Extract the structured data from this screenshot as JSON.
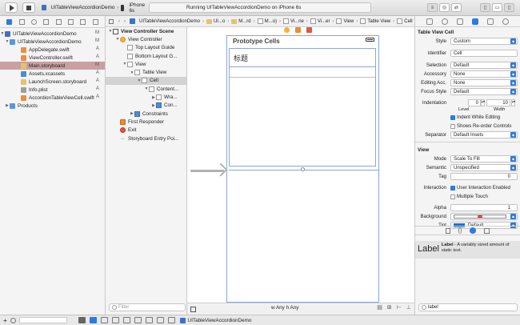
{
  "toolbar": {
    "scheme_target": "UITableViewAccordionDemo",
    "scheme_device": "iPhone 6s",
    "activity": "Running UITableViewAccordionDemo on iPhone 6s",
    "left_icons": [
      "run-icon",
      "stop-icon"
    ],
    "right_icons": [
      "editor-standard-icon",
      "editor-assistant-icon",
      "editor-version-icon",
      "navigator-toggle-icon",
      "debug-toggle-icon",
      "utilities-toggle-icon"
    ]
  },
  "navigator": {
    "project": {
      "name": "UITableViewAccordionDemo",
      "badge": "M"
    },
    "group": {
      "name": "UITableViewAccordionDemo",
      "badge": "M"
    },
    "files": [
      {
        "name": "AppDelegate.swift",
        "badge": "A",
        "kind": "swift"
      },
      {
        "name": "ViewController.swift",
        "badge": "A",
        "kind": "swift"
      },
      {
        "name": "Main.storyboard",
        "badge": "M",
        "kind": "storyboard"
      },
      {
        "name": "Assets.xcassets",
        "badge": "A",
        "kind": "assets"
      },
      {
        "name": "LaunchScreen.storyboard",
        "badge": "A",
        "kind": "storyboard"
      },
      {
        "name": "Info.plist",
        "badge": "A",
        "kind": "plist"
      },
      {
        "name": "AccordionTableViewCell.swift",
        "badge": "A",
        "kind": "swift"
      }
    ],
    "products": {
      "name": "Products"
    },
    "selected_file": "Main.storyboard"
  },
  "breadcrumbs": [
    "UITableViewAccordionDemo",
    "UI...o",
    "M...rd",
    "M...o)",
    "Vi...ne",
    "Vi...er",
    "View",
    "Table View",
    "Cell"
  ],
  "outline": {
    "scene": "View Controller Scene",
    "items": [
      {
        "label": "View Controller",
        "indent": 1,
        "icon": "vc"
      },
      {
        "label": "Top Layout Guide",
        "indent": 2,
        "icon": "box"
      },
      {
        "label": "Bottom Layout G...",
        "indent": 2,
        "icon": "box"
      },
      {
        "label": "View",
        "indent": 2,
        "icon": "box"
      },
      {
        "label": "Table View",
        "indent": 3,
        "icon": "box"
      },
      {
        "label": "Cell",
        "indent": 4,
        "icon": "box"
      },
      {
        "label": "Content...",
        "indent": 5,
        "icon": "box"
      },
      {
        "label": "Wra...",
        "indent": 6,
        "icon": "box"
      },
      {
        "label": "Con...",
        "indent": 6,
        "icon": "blue"
      },
      {
        "label": "Constraints",
        "indent": 3,
        "icon": "blue"
      },
      {
        "label": "First Responder",
        "indent": 1,
        "icon": "orange"
      },
      {
        "label": "Exit",
        "indent": 1,
        "icon": "red"
      },
      {
        "label": "Storyboard Entry Poi...",
        "indent": 1,
        "icon": "arrow"
      }
    ],
    "filter_placeholder": "Filter"
  },
  "canvas": {
    "prototype_label": "Prototype Cells",
    "cell_text": "标题",
    "size_class_w": "Any",
    "size_class_h": "Any",
    "size_class_prefix_w": "w",
    "size_class_prefix_h": "h"
  },
  "status_bar": {
    "target": "UITableViewAccordionDemo"
  },
  "inspector": {
    "section_cell": "Table View Cell",
    "style": {
      "label": "Style",
      "value": "Custom"
    },
    "identifier": {
      "label": "Identifier",
      "value": "Cell"
    },
    "selection": {
      "label": "Selection",
      "value": "Default"
    },
    "accessory": {
      "label": "Accessory",
      "value": "None"
    },
    "editing_acc": {
      "label": "Editing Acc.",
      "value": "None"
    },
    "focus_style": {
      "label": "Focus Style",
      "value": "Default"
    },
    "indentation": {
      "label": "Indentation",
      "level": "0",
      "width": "10",
      "level_label": "Level",
      "width_label": "Width"
    },
    "indent_while_editing": {
      "label": "Indent While Editing",
      "checked": true
    },
    "shows_reorder": {
      "label": "Shows Re-order Controls",
      "checked": false
    },
    "separator": {
      "label": "Separator",
      "value": "Default Insets"
    },
    "section_view": "View",
    "mode": {
      "label": "Mode",
      "value": "Scale To Fill"
    },
    "semantic": {
      "label": "Semantic",
      "value": "Unspecified"
    },
    "tag": {
      "label": "Tag",
      "value": "0"
    },
    "interaction": {
      "label": "Interaction",
      "user_interaction": "User Interaction Enabled",
      "multiple_touch": "Multiple Touch"
    },
    "alpha": {
      "label": "Alpha",
      "value": "1"
    },
    "background": {
      "label": "Background"
    },
    "tint": {
      "label": "Tint",
      "value": "Default"
    },
    "library": {
      "item_icon_text": "Label",
      "item_title": "Label",
      "item_desc": " - A variably sized amount of static text.",
      "search_value": "label"
    }
  },
  "colors": {
    "accent": "#2d7ae0",
    "selected_file_bg": "#c9a1a1",
    "frame_blue": "#8aa7d6"
  }
}
